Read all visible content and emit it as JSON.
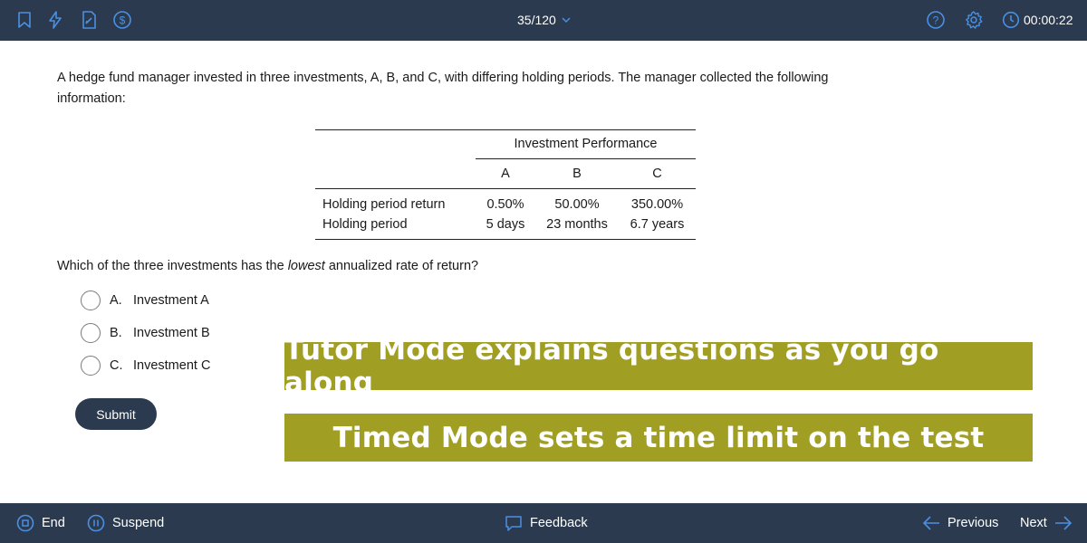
{
  "topbar": {
    "icons": [
      "bookmark-icon",
      "lightning-icon",
      "notes-icon",
      "dollar-icon",
      "help-icon",
      "gear-icon",
      "clock-icon"
    ],
    "question_counter": "35/120",
    "timer": "00:00:22"
  },
  "question": {
    "stem": "A hedge fund manager invested in three investments, A, B, and C, with differing holding periods.  The manager collected the following information:",
    "table": {
      "caption": "Investment Performance",
      "columns": [
        "A",
        "B",
        "C"
      ],
      "rows": [
        {
          "label": "Holding period return",
          "values": [
            "0.50%",
            "50.00%",
            "350.00%"
          ]
        },
        {
          "label": "Holding period",
          "values": [
            "5 days",
            "23 months",
            "6.7 years"
          ]
        }
      ]
    },
    "prompt_before": "Which of the three investments has the ",
    "prompt_emphasis": "lowest",
    "prompt_after": " annualized rate of return?",
    "options": [
      {
        "letter": "A.",
        "text": "Investment A"
      },
      {
        "letter": "B.",
        "text": "Investment B"
      },
      {
        "letter": "C.",
        "text": "Investment C"
      }
    ],
    "submit_label": "Submit"
  },
  "banners": [
    "Tutor Mode explains questions as you go along",
    "Timed Mode sets a time limit on the test"
  ],
  "bottombar": {
    "end_label": "End",
    "suspend_label": "Suspend",
    "feedback_label": "Feedback",
    "previous_label": "Previous",
    "next_label": "Next"
  },
  "colors": {
    "bar_background": "#2b3a4e",
    "icon_blue": "#4a90e2",
    "banner_olive": "#a19e24"
  }
}
